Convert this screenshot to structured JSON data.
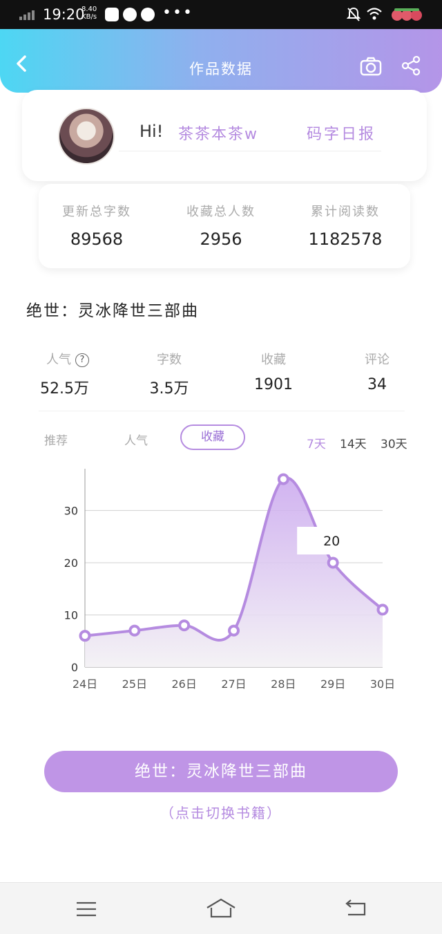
{
  "status_bar": {
    "time": "19:20",
    "net_speed_value": "8.40",
    "net_speed_unit": "KB/s"
  },
  "header": {
    "title": "作品数据"
  },
  "profile": {
    "greeting": "Hi!",
    "username": "茶茶本茶w",
    "daily_link": "码字日报"
  },
  "stats": [
    {
      "label": "更新总字数",
      "value": "89568"
    },
    {
      "label": "收藏总人数",
      "value": "2956"
    },
    {
      "label": "累计阅读数",
      "value": "1182578"
    }
  ],
  "book": {
    "title": "绝世：灵冰降世三部曲"
  },
  "metrics": [
    {
      "label": "人气",
      "value": "52.5万"
    },
    {
      "label": "字数",
      "value": "3.5万"
    },
    {
      "label": "收藏",
      "value": "1901"
    },
    {
      "label": "评论",
      "value": "34"
    }
  ],
  "tabs": [
    "推荐",
    "人气",
    "收藏"
  ],
  "active_tab": "收藏",
  "ranges": [
    "7天",
    "14天",
    "30天"
  ],
  "active_range": "7天",
  "chart_data": {
    "type": "line",
    "categories": [
      "24日",
      "25日",
      "26日",
      "27日",
      "28日",
      "29日",
      "30日"
    ],
    "values": [
      6,
      7,
      8,
      7,
      36,
      20,
      11
    ],
    "yticks": [
      0,
      10,
      20,
      30
    ],
    "ylim": [
      0,
      38
    ],
    "smooth": true,
    "area_fill": true,
    "grid": true,
    "tooltip": {
      "category": "29日",
      "value": "20"
    },
    "line_color": "#b58be0"
  },
  "footer": {
    "book_button": "绝世：灵冰降世三部曲",
    "switch_hint": "（点击切换书籍）"
  },
  "colors": {
    "accent": "#b58be0",
    "button": "#bf95e6"
  }
}
